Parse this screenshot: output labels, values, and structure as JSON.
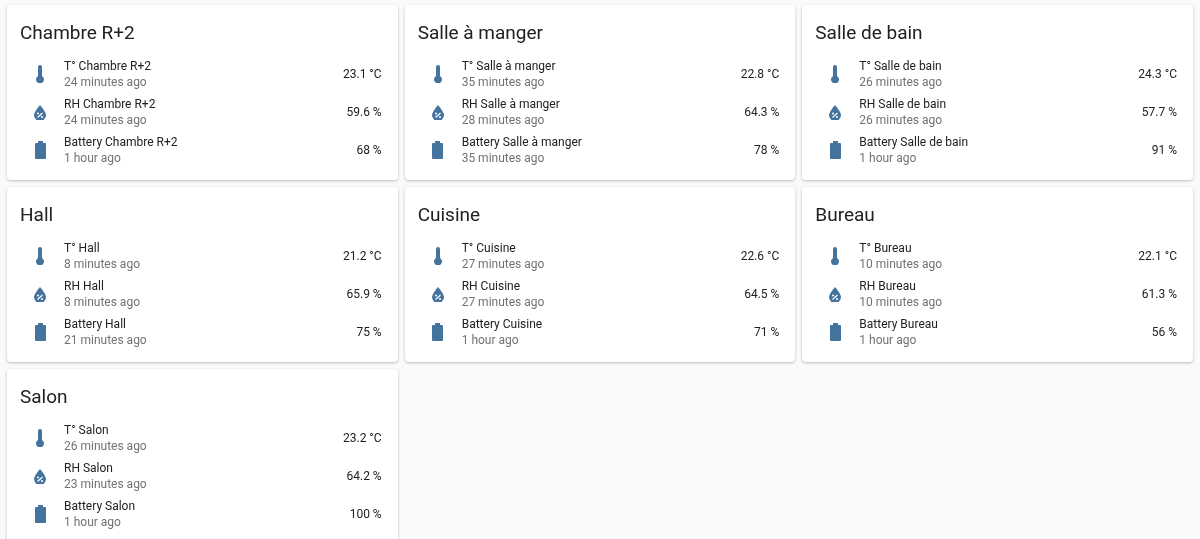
{
  "cards": [
    {
      "title": "Chambre R+2",
      "entities": [
        {
          "kind": "temperature",
          "name": "T° Chambre R+2",
          "updated": "24 minutes ago",
          "value": "23.1 °C"
        },
        {
          "kind": "humidity",
          "name": "RH Chambre R+2",
          "updated": "24 minutes ago",
          "value": "59.6 %"
        },
        {
          "kind": "battery",
          "name": "Battery Chambre R+2",
          "updated": "1 hour ago",
          "value": "68 %"
        }
      ]
    },
    {
      "title": "Salle à manger",
      "entities": [
        {
          "kind": "temperature",
          "name": "T° Salle à manger",
          "updated": "35 minutes ago",
          "value": "22.8 °C"
        },
        {
          "kind": "humidity",
          "name": "RH Salle à manger",
          "updated": "28 minutes ago",
          "value": "64.3 %"
        },
        {
          "kind": "battery",
          "name": "Battery Salle à manger",
          "updated": "35 minutes ago",
          "value": "78 %"
        }
      ]
    },
    {
      "title": "Salle de bain",
      "entities": [
        {
          "kind": "temperature",
          "name": "T° Salle de bain",
          "updated": "26 minutes ago",
          "value": "24.3 °C"
        },
        {
          "kind": "humidity",
          "name": "RH Salle de bain",
          "updated": "26 minutes ago",
          "value": "57.7 %"
        },
        {
          "kind": "battery",
          "name": "Battery Salle de bain",
          "updated": "1 hour ago",
          "value": "91 %"
        }
      ]
    },
    {
      "title": "Hall",
      "entities": [
        {
          "kind": "temperature",
          "name": "T° Hall",
          "updated": "8 minutes ago",
          "value": "21.2 °C"
        },
        {
          "kind": "humidity",
          "name": "RH Hall",
          "updated": "8 minutes ago",
          "value": "65.9 %"
        },
        {
          "kind": "battery",
          "name": "Battery Hall",
          "updated": "21 minutes ago",
          "value": "75 %"
        }
      ]
    },
    {
      "title": "Cuisine",
      "entities": [
        {
          "kind": "temperature",
          "name": "T° Cuisine",
          "updated": "27 minutes ago",
          "value": "22.6 °C"
        },
        {
          "kind": "humidity",
          "name": "RH Cuisine",
          "updated": "27 minutes ago",
          "value": "64.5 %"
        },
        {
          "kind": "battery",
          "name": "Battery Cuisine",
          "updated": "1 hour ago",
          "value": "71 %"
        }
      ]
    },
    {
      "title": "Bureau",
      "entities": [
        {
          "kind": "temperature",
          "name": "T° Bureau",
          "updated": "10 minutes ago",
          "value": "22.1 °C"
        },
        {
          "kind": "humidity",
          "name": "RH Bureau",
          "updated": "10 minutes ago",
          "value": "61.3 %"
        },
        {
          "kind": "battery",
          "name": "Battery Bureau",
          "updated": "1 hour ago",
          "value": "56 %"
        }
      ]
    },
    {
      "title": "Salon",
      "entities": [
        {
          "kind": "temperature",
          "name": "T° Salon",
          "updated": "26 minutes ago",
          "value": "23.2 °C"
        },
        {
          "kind": "humidity",
          "name": "RH Salon",
          "updated": "23 minutes ago",
          "value": "64.2 %"
        },
        {
          "kind": "battery",
          "name": "Battery Salon",
          "updated": "1 hour ago",
          "value": "100 %"
        }
      ]
    }
  ]
}
